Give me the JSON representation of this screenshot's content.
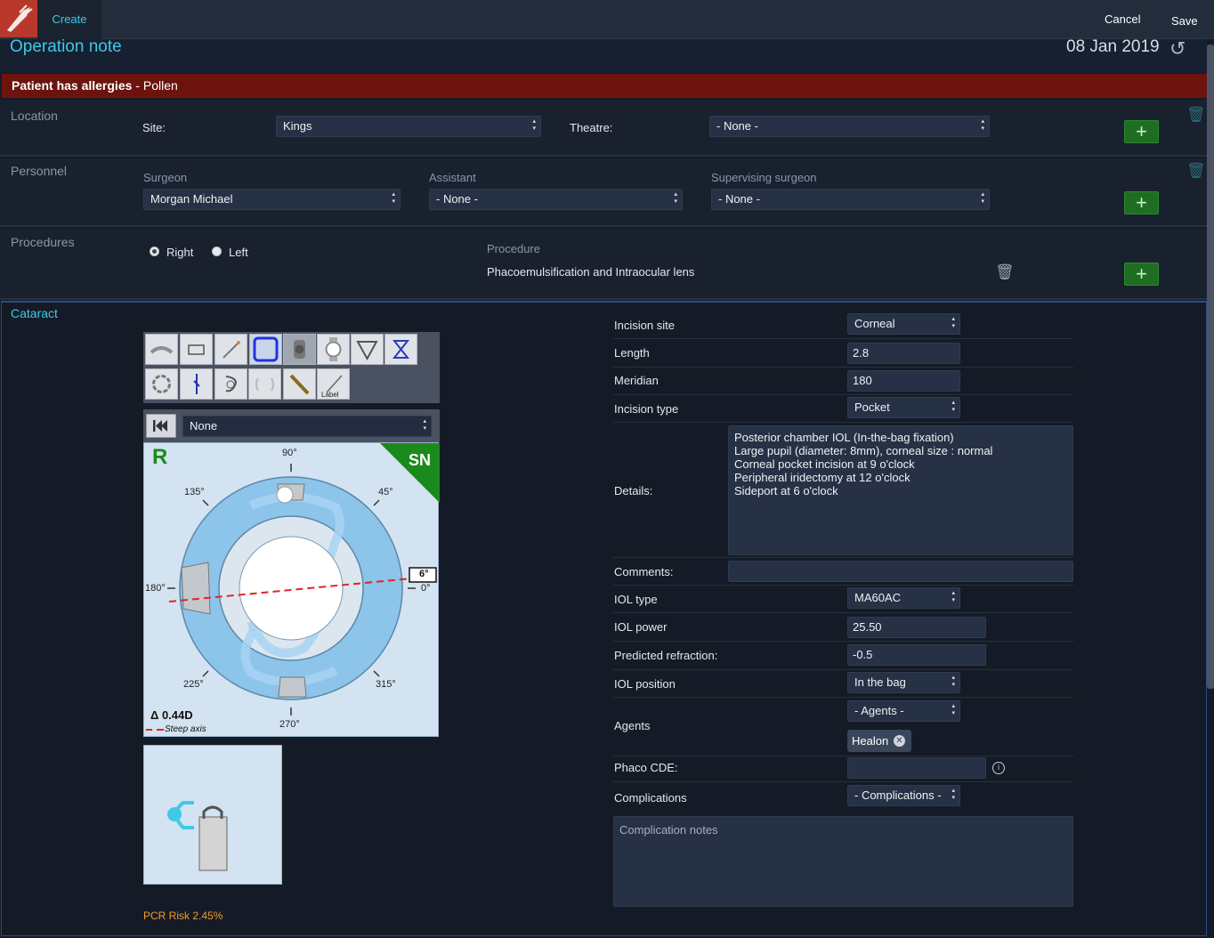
{
  "topbar": {
    "create_label": "Create",
    "cancel_label": "Cancel",
    "save_label": "Save"
  },
  "header": {
    "title": "Operation note",
    "date": "08 Jan 2019"
  },
  "allergy": {
    "prefix": "Patient has allergies",
    "separator": " - ",
    "allergen": "Pollen"
  },
  "location": {
    "section_label": "Location",
    "site_label": "Site:",
    "site_value": "Kings",
    "theatre_label": "Theatre:",
    "theatre_value": "- None -"
  },
  "personnel": {
    "section_label": "Personnel",
    "surgeon_label": "Surgeon",
    "surgeon_value": "Morgan Michael",
    "assistant_label": "Assistant",
    "assistant_value": "- None -",
    "supervising_label": "Supervising surgeon",
    "supervising_value": "- None -"
  },
  "procedures": {
    "section_label": "Procedures",
    "eye_right": "Right",
    "eye_left": "Left",
    "selected_eye": "Right",
    "procedure_header": "Procedure",
    "procedure_name": "Phacoemulsification and Intraocular lens"
  },
  "cataract": {
    "section_label": "Cataract",
    "tools_row1": [
      "corneal-incision",
      "scleral-incision",
      "needle",
      "capsulorhexis",
      "phaco-probe",
      "iol",
      "iridectomy",
      "hourglass"
    ],
    "tools_row2": [
      "iris-hooks",
      "suture",
      "pupil-stretch",
      "capsular-tension-ring",
      "cannula",
      "label"
    ],
    "tool_label_text": "Label",
    "reset_select": "None",
    "eye_letter": "R",
    "corner_label": "SN",
    "angles": {
      "a90": "90°",
      "a45": "45°",
      "a135": "135°",
      "a180": "180°",
      "a0": "0°",
      "a225": "225°",
      "a315": "315°",
      "a270": "270°"
    },
    "axis_box": "6°",
    "delta": "Δ 0.44D",
    "steep_axis": "Steep axis",
    "pcr_risk": "PCR Risk 2.45%"
  },
  "form": {
    "incision_site_label": "Incision site",
    "incision_site_value": "Corneal",
    "length_label": "Length",
    "length_value": "2.8",
    "meridian_label": "Meridian",
    "meridian_value": "180",
    "incision_type_label": "Incision type",
    "incision_type_value": "Pocket",
    "details_label": "Details:",
    "details_lines": [
      "Posterior chamber IOL (In-the-bag fixation)",
      "Large pupil (diameter: 8mm), corneal size : normal",
      "Corneal pocket incision at 9 o'clock",
      "Peripheral iridectomy at 12 o'clock",
      "Sideport at 6 o'clock"
    ],
    "comments_label": "Comments:",
    "iol_type_label": "IOL type",
    "iol_type_value": "MA60AC",
    "iol_power_label": "IOL power",
    "iol_power_value": "25.50",
    "predicted_label": "Predicted refraction:",
    "predicted_value": "-0.5",
    "iol_position_label": "IOL position",
    "iol_position_value": "In the bag",
    "agents_label": "Agents",
    "agents_select": "- Agents -",
    "agent_chip": "Healon",
    "phaco_label": "Phaco CDE:",
    "complications_label": "Complications",
    "complications_select": "- Complications -",
    "complication_notes_placeholder": "Complication notes"
  },
  "colors": {
    "accent": "#3ec9e6",
    "allergy_bg": "#6d130e",
    "add_green": "#1f6d22",
    "pcr_orange": "#f39c26"
  }
}
